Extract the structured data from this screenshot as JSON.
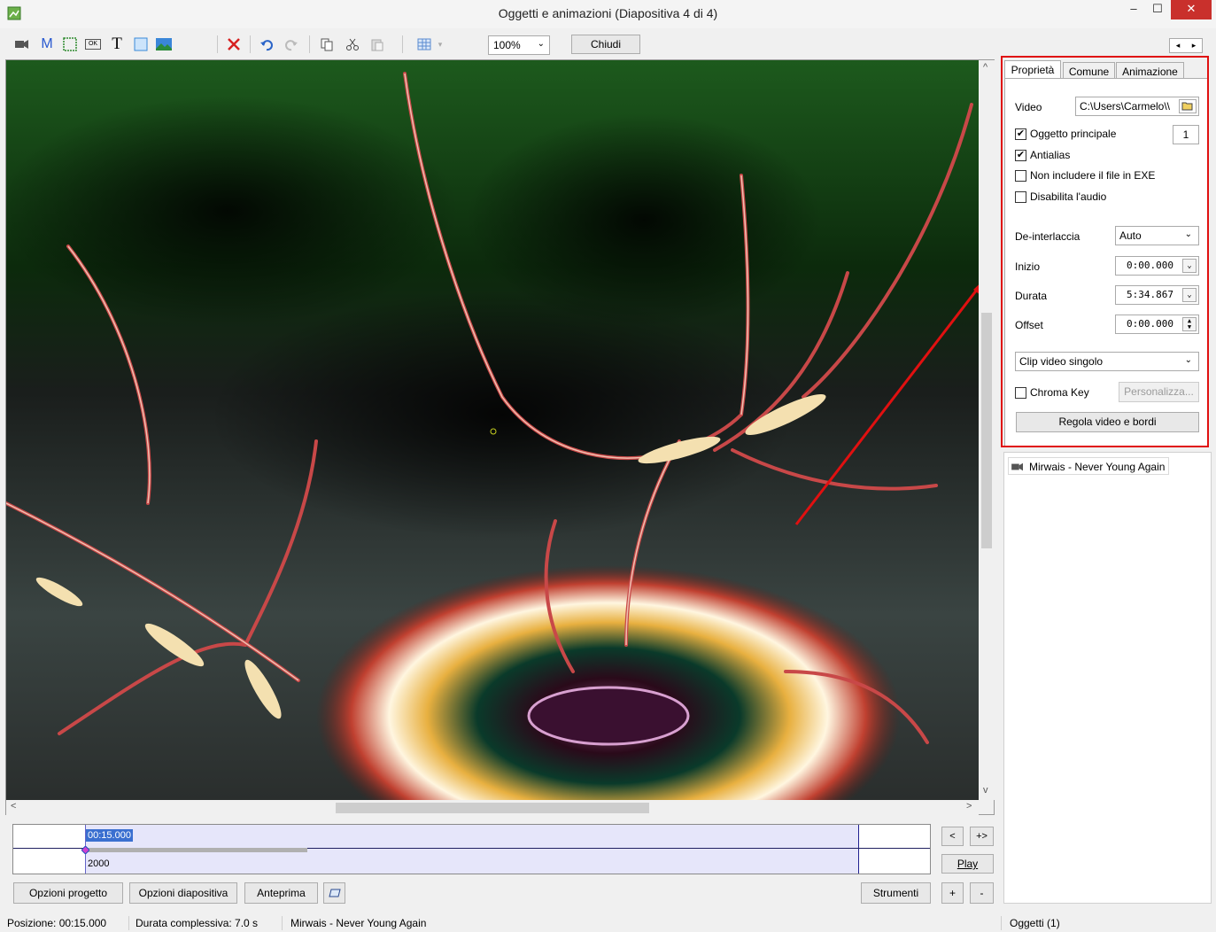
{
  "window": {
    "title": "Oggetti e animazioni  (Diapositiva 4 di 4)",
    "min_glyph": "–",
    "max_glyph": "☐",
    "close_glyph": "✕"
  },
  "toolbar": {
    "icons": [
      "video-icon",
      "mask-icon",
      "frame-icon",
      "button-icon",
      "text-icon",
      "rectangle-icon",
      "image-icon",
      "delete-icon",
      "undo-icon",
      "redo-icon",
      "copy-icon",
      "cut-icon",
      "paste-icon",
      "grid-icon"
    ],
    "mask_label": "M",
    "text_label": "T",
    "button_label": "OK",
    "zoom": "100%",
    "close_label": "Chiudi",
    "nav_prev": "◂",
    "nav_next": "▸"
  },
  "timeline": {
    "time": "00:15.000",
    "value": "2000",
    "prev_label": "<",
    "next_label": "+>",
    "play_label": "Play",
    "add_label": "+",
    "remove_label": "-"
  },
  "buttons": {
    "project_options": "Opzioni progetto",
    "slide_options": "Opzioni diapositiva",
    "preview": "Anteprima",
    "tools": "Strumenti"
  },
  "status": {
    "position": "Posizione:  00:15.000",
    "total": "Durata complessiva:  7.0 s",
    "track": "Mirwais - Never Young Again",
    "objects": "Oggetti (1)"
  },
  "panel": {
    "tabs": [
      "Proprietà",
      "Comune",
      "Animazione"
    ],
    "video_label": "Video",
    "video_path": "C:\\Users\\Carmelo\\\\",
    "main_object_label": "Oggetto principale",
    "main_object_checked": true,
    "main_object_number": "1",
    "antialias_label": "Antialias",
    "antialias_checked": true,
    "exclude_exe_label": "Non includere il file in EXE",
    "disable_audio_label": "Disabilita l'audio",
    "deinterlace_label": "De-interlaccia",
    "deinterlace_value": "Auto",
    "start_label": "Inizio",
    "start_value": "0:00.000",
    "duration_label": "Durata",
    "duration_value": "5:34.867",
    "offset_label": "Offset",
    "offset_value": "0:00.000",
    "clip_mode": "Clip video singolo",
    "chroma_label": "Chroma Key",
    "customize_label": "Personalizza...",
    "adjust_label": "Regola video e bordi"
  },
  "object_list": {
    "item": "Mirwais - Never Young Again"
  },
  "colors": {
    "accent": "#3a6fd0",
    "highlight_box": "#e01010",
    "arrow": "#e01010"
  }
}
